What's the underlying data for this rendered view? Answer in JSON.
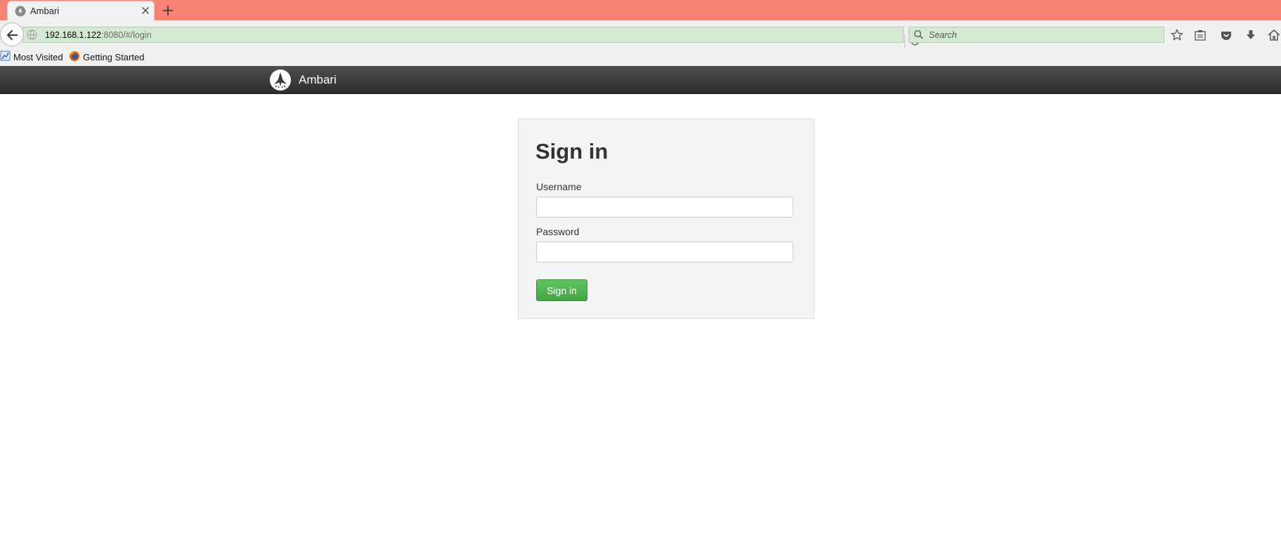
{
  "browser": {
    "tab": {
      "title": "Ambari",
      "favicon": "ambari-logo-icon",
      "close_icon": "close-icon"
    },
    "new_tab_icon": "plus-icon",
    "url": {
      "host": "192.168.1.122",
      "rest": ":8080/#/login"
    },
    "search": {
      "placeholder": "Search"
    },
    "toolbar_icons": [
      "star-icon",
      "reading-list-icon",
      "pocket-icon",
      "download-icon",
      "home-icon"
    ],
    "bookmarks": [
      {
        "label": "Most Visited",
        "icon": "most-visited-icon"
      },
      {
        "label": "Getting Started",
        "icon": "firefox-icon"
      }
    ],
    "colors": {
      "tabstrip": "#f78374",
      "urlbar": "#d5ead2"
    }
  },
  "app": {
    "brand": {
      "name": "Ambari",
      "logo": "ambari-logo-icon"
    },
    "header_color": "#333333"
  },
  "login": {
    "title": "Sign in",
    "username_label": "Username",
    "username_value": "",
    "password_label": "Password",
    "password_value": "",
    "submit_label": "Sign in",
    "submit_color": "#5cb85c"
  }
}
